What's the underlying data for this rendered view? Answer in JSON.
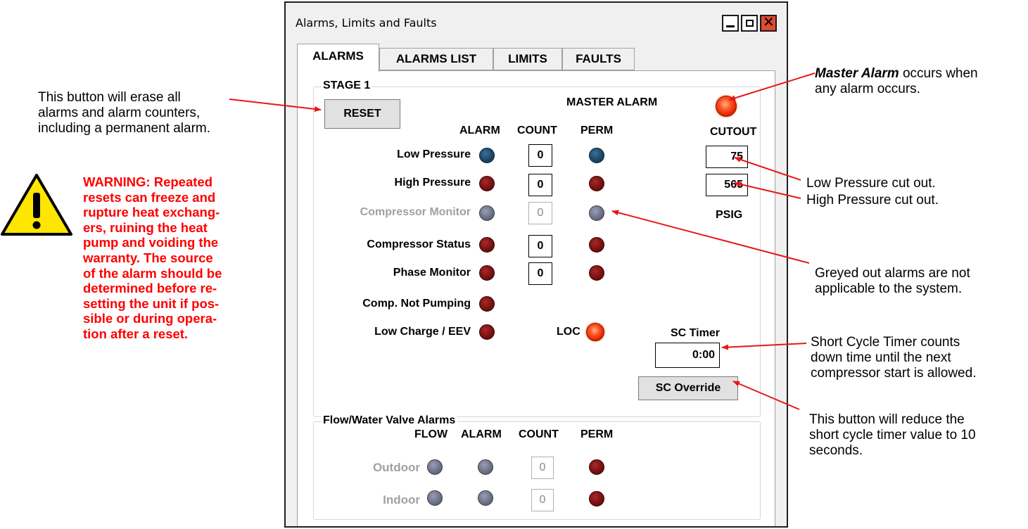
{
  "window": {
    "title": "Alarms, Limits and Faults",
    "tabs": [
      "ALARMS",
      "ALARMS LIST",
      "LIMITS",
      "FAULTS"
    ],
    "active_tab": "ALARMS"
  },
  "stage": {
    "group_label": "STAGE 1",
    "reset_label": "RESET",
    "master_alarm_label": "MASTER ALARM",
    "headers": {
      "alarm": "ALARM",
      "count": "COUNT",
      "perm": "PERM",
      "cutout": "CUTOUT"
    },
    "rows": [
      {
        "label": "Low Pressure",
        "alarm": "blue",
        "count": "0",
        "perm": "blue",
        "enabled": true
      },
      {
        "label": "High Pressure",
        "alarm": "dark-red",
        "count": "0",
        "perm": "dark-red",
        "enabled": true
      },
      {
        "label": "Compressor Monitor",
        "alarm": "grey",
        "count": "0",
        "perm": "grey",
        "enabled": false
      },
      {
        "label": "Compressor Status",
        "alarm": "dark-red",
        "count": "0",
        "perm": "dark-red",
        "enabled": true
      },
      {
        "label": "Phase Monitor",
        "alarm": "dark-red",
        "count": "0",
        "perm": "dark-red",
        "enabled": true
      },
      {
        "label": "Comp. Not Pumping",
        "alarm": "dark-red",
        "enabled": true
      },
      {
        "label": "Low Charge / EEV",
        "alarm": "dark-red",
        "enabled": true
      }
    ],
    "cutout_low": "75",
    "cutout_high": "565",
    "units": "PSIG",
    "loc_label": "LOC",
    "sc_timer_label": "SC Timer",
    "sc_timer_value": "0:00",
    "sc_override_label": "SC Override"
  },
  "flow": {
    "group_label": "Flow/Water Valve Alarms",
    "headers": {
      "flow": "FLOW",
      "alarm": "ALARM",
      "count": "COUNT",
      "perm": "PERM"
    },
    "rows": [
      {
        "label": "Outdoor",
        "count": "0"
      },
      {
        "label": "Indoor",
        "count": "0"
      }
    ]
  },
  "annotations": {
    "reset_note": [
      "This button will erase all",
      "alarms and alarm counters,",
      "including a permanent alarm."
    ],
    "warning_lines": [
      "WARNING:  Repeated",
      "resets can freeze and",
      "rupture heat exchang-",
      "ers, ruining the heat",
      "pump and voiding the",
      "warranty.  The source",
      "of the alarm should be",
      "determined before re-",
      "setting the unit if pos-",
      "sible or during opera-",
      "tion after a reset."
    ],
    "master_note_em": "Master Alarm",
    "master_note_rest": " occurs when",
    "master_note_line2": "any alarm occurs.",
    "low_cutout_note": "Low Pressure cut out.",
    "high_cutout_note": "High Pressure cut out.",
    "greyed_note": [
      "Greyed out alarms are not",
      "applicable to the system."
    ],
    "sc_timer_note": [
      "Short Cycle Timer counts",
      "down time until the next",
      "compressor start is allowed."
    ],
    "sc_override_note": [
      "This button will reduce the",
      "short cycle timer value to 10",
      "seconds."
    ]
  },
  "colors": {
    "arrow": "#e8161b",
    "warning_text": "#ff0000",
    "warning_sign": "#ffe600"
  }
}
